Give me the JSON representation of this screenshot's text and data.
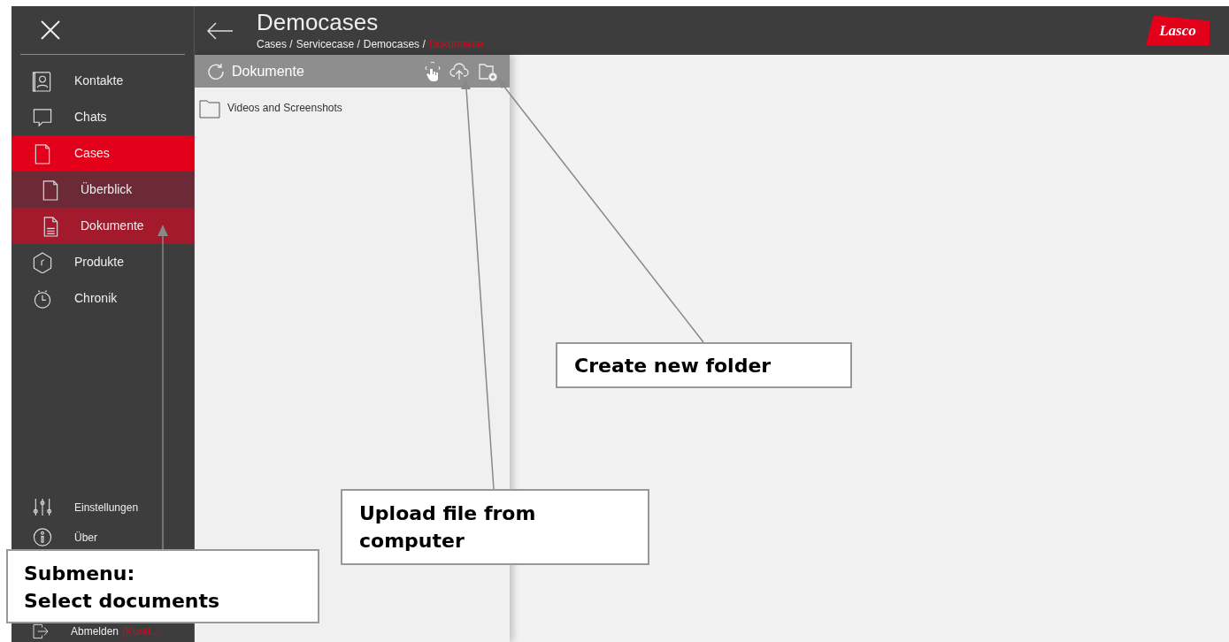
{
  "header": {
    "title": "Democases",
    "logo": "Lasco",
    "breadcrumb": [
      {
        "label": "Cases /",
        "current": false
      },
      {
        "label": "Servicecase /",
        "current": false
      },
      {
        "label": "Democases /",
        "current": false
      },
      {
        "label": "Dokumente",
        "current": true
      }
    ]
  },
  "sidebar": {
    "items": [
      {
        "label": "Kontakte",
        "selected": false
      },
      {
        "label": "Chats",
        "selected": false
      },
      {
        "label": "Cases",
        "selected": true,
        "children": [
          {
            "label": "Überblick",
            "selected": false
          },
          {
            "label": "Dokumente",
            "selected": true
          }
        ]
      },
      {
        "label": "Produkte",
        "selected": false
      },
      {
        "label": "Chronik",
        "selected": false
      }
    ],
    "footer_items": [
      {
        "label": "Einstellungen"
      },
      {
        "label": "Über"
      },
      {
        "label": "Abmelden",
        "user": "(Kund..."
      }
    ]
  },
  "panel": {
    "title": "Dokumente",
    "files": [
      {
        "name": "Videos and Screenshots"
      }
    ]
  },
  "annotations": [
    {
      "text": "Create new folder"
    },
    {
      "text": "Upload file from computer"
    },
    {
      "text": "Submenu:\nSelect documents"
    }
  ]
}
